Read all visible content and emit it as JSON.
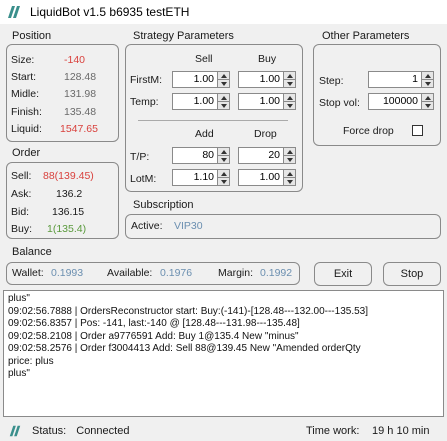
{
  "window": {
    "title": "LiquidBot v1.5 b6935 testETH"
  },
  "position": {
    "label": "Position",
    "rows": [
      {
        "name": "Size:",
        "value": "-140"
      },
      {
        "name": "Start:",
        "value": "128.48"
      },
      {
        "name": "Midle:",
        "value": "131.98"
      },
      {
        "name": "Finish:",
        "value": "135.48"
      },
      {
        "name": "Liquid:",
        "value": "1547.65"
      }
    ]
  },
  "order": {
    "label": "Order",
    "rows": [
      {
        "name": "Sell:",
        "value": "88(139.45)"
      },
      {
        "name": "Ask:",
        "value": "136.2"
      },
      {
        "name": "Bid:",
        "value": "136.15"
      },
      {
        "name": "Buy:",
        "value": "1(135.4)"
      }
    ]
  },
  "strategy": {
    "label": "Strategy Parameters",
    "col_sell": "Sell",
    "col_buy": "Buy",
    "firstm_label": "FirstM:",
    "firstm_sell": "1.00",
    "firstm_buy": "1.00",
    "temp_label": "Temp:",
    "temp_sell": "1.00",
    "temp_buy": "1.00",
    "col_add": "Add",
    "col_drop": "Drop",
    "tp_label": "T/P:",
    "tp_add": "80",
    "tp_drop": "20",
    "lotm_label": "LotM:",
    "lotm_add": "1.10",
    "lotm_drop": "1.00"
  },
  "other": {
    "label": "Other Parameters",
    "step_label": "Step:",
    "step_value": "1",
    "stopvol_label": "Stop vol:",
    "stopvol_value": "100000",
    "forcedrop_label": "Force drop"
  },
  "subscription": {
    "label": "Subscription",
    "active_label": "Active:",
    "active_value": "VIP30"
  },
  "balance": {
    "label": "Balance",
    "wallet_label": "Wallet:",
    "wallet_value": "0.1993",
    "available_label": "Available:",
    "available_value": "0.1976",
    "margin_label": "Margin:",
    "margin_value": "0.1992"
  },
  "buttons": {
    "exit": "Exit",
    "stop": "Stop"
  },
  "log": [
    "plus\"",
    "09:02:56.7888 | OrdersReconstructor start: Buy:(-141)-[128.48---132.00---135.53]",
    "09:02:56.8357 | Pos: -141, last:-140 @ [128.48---131.98---135.48]",
    "09:02:58.2108 | Order a9776591 Add: Buy 1@135.4 New \"minus\"",
    "09:02:58.2576 | Order f3004413 Add: Sell 88@139.45 New \"Amended orderQty",
    "price: plus",
    "plus\""
  ],
  "status": {
    "status_label": "Status:",
    "status_value": "Connected",
    "timework_label": "Time work:",
    "timework_value": "19 h 10 min"
  },
  "colors": {
    "accent_red": "#d9413d",
    "accent_blue": "#6b8fb0",
    "accent_green": "#5a9a3c",
    "logo_teal": "#3a8f8c"
  }
}
